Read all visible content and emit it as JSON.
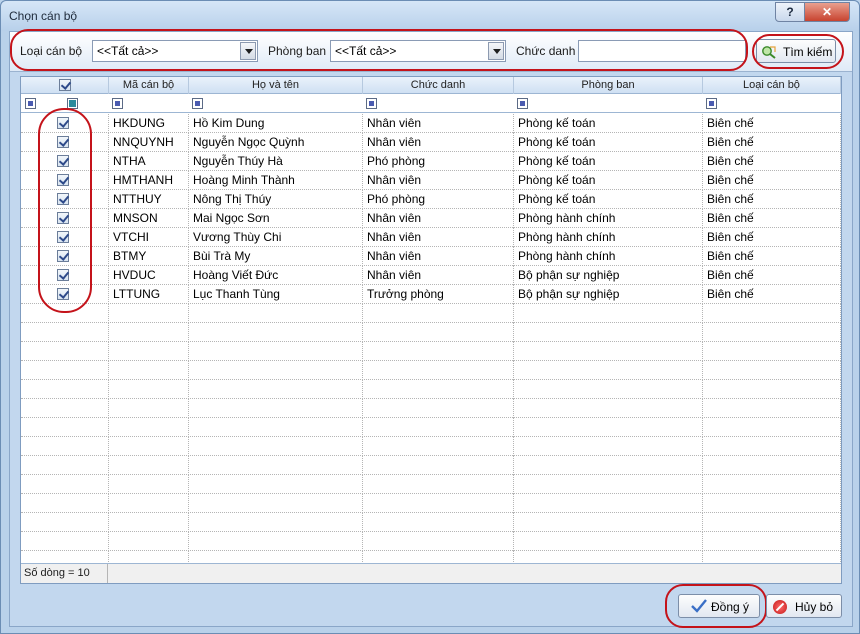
{
  "window": {
    "title": "Chọn cán bộ",
    "help_label": "?",
    "close_label": "✕"
  },
  "filters": {
    "loai_label": "Loại cán bộ",
    "loai_value": "<<Tất cả>>",
    "phong_label": "Phòng ban",
    "phong_value": "<<Tất cả>>",
    "chucdanh_label": "Chức danh",
    "chucdanh_value": "",
    "search_label": "Tìm kiếm"
  },
  "grid": {
    "headers": [
      "Mã cán bộ",
      "Họ và tên",
      "Chức danh",
      "Phòng ban",
      "Loại cán bộ"
    ],
    "rows": [
      {
        "checked": true,
        "ma": "HKDUNG",
        "ten": "Hồ Kim Dung",
        "chucdanh": "Nhân viên",
        "phongban": "Phòng kế toán",
        "loai": "Biên chế"
      },
      {
        "checked": true,
        "ma": "NNQUYNH",
        "ten": "Nguyễn Ngọc Quỳnh",
        "chucdanh": "Nhân viên",
        "phongban": "Phòng kế toán",
        "loai": "Biên chế"
      },
      {
        "checked": true,
        "ma": "NTHA",
        "ten": "Nguyễn Thúy Hà",
        "chucdanh": "Phó phòng",
        "phongban": "Phòng kế toán",
        "loai": "Biên chế"
      },
      {
        "checked": true,
        "ma": "HMTHANH",
        "ten": "Hoàng Minh Thành",
        "chucdanh": "Nhân viên",
        "phongban": "Phòng kế toán",
        "loai": "Biên chế"
      },
      {
        "checked": true,
        "ma": "NTTHUY",
        "ten": "Nông Thị Thúy",
        "chucdanh": "Phó phòng",
        "phongban": "Phòng kế toán",
        "loai": "Biên chế"
      },
      {
        "checked": true,
        "ma": "MNSON",
        "ten": "Mai Ngọc Sơn",
        "chucdanh": "Nhân viên",
        "phongban": "Phòng hành chính",
        "loai": "Biên chế"
      },
      {
        "checked": true,
        "ma": "VTCHI",
        "ten": "Vương Thùy Chi",
        "chucdanh": "Nhân viên",
        "phongban": "Phòng hành chính",
        "loai": "Biên chế"
      },
      {
        "checked": true,
        "ma": "BTMY",
        "ten": "Bùi Trà My",
        "chucdanh": "Nhân viên",
        "phongban": "Phòng hành chính",
        "loai": "Biên chế"
      },
      {
        "checked": true,
        "ma": "HVDUC",
        "ten": "Hoàng Viết Đức",
        "chucdanh": "Nhân viên",
        "phongban": "Bộ phận sự nghiệp",
        "loai": "Biên chế"
      },
      {
        "checked": true,
        "ma": "LTTUNG",
        "ten": "Lục Thanh Tùng",
        "chucdanh": "Trưởng phòng",
        "phongban": "Bộ phận sự nghiệp",
        "loai": "Biên chế"
      }
    ],
    "row_count_text": "Số dòng = 10"
  },
  "buttons": {
    "ok_label": "Đồng ý",
    "cancel_label": "Hủy bỏ"
  },
  "colors": {
    "annotation_red": "#c4131a",
    "window_bg": "#b9d1ea"
  }
}
